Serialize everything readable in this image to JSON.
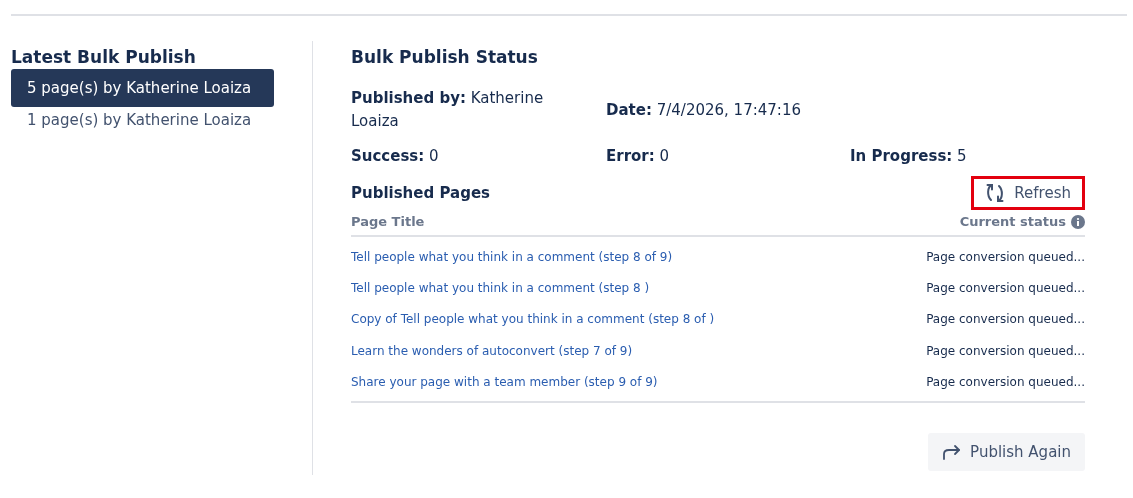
{
  "sidebar": {
    "title": "Latest Bulk Publish",
    "items": [
      {
        "label": "5 page(s) by Katherine Loaiza",
        "selected": true
      },
      {
        "label": "1 page(s) by Katherine Loaiza",
        "selected": false
      }
    ]
  },
  "main": {
    "title": "Bulk Publish Status",
    "field_rows": [
      [
        {
          "label": "Published by:",
          "value": "Katherine Loaiza"
        },
        {
          "label": "Date:",
          "value": "7/4/2026, 17:47:16"
        }
      ],
      [
        {
          "label": "Success:",
          "value": "0"
        },
        {
          "label": "Error:",
          "value": "0"
        },
        {
          "label": "In Progress:",
          "value": "5"
        }
      ]
    ],
    "pages_title": "Published Pages",
    "refresh": {
      "label": "Refresh",
      "highlighted": true
    },
    "table": {
      "columns": [
        "Page Title",
        "Current status"
      ],
      "rows": [
        {
          "title": "Tell people what you think in a comment (step 8 of 9)",
          "status": "Page conversion queued..."
        },
        {
          "title": "Tell people what you think in a comment (step 8 )",
          "status": "Page conversion queued..."
        },
        {
          "title": "Copy of Tell people what you think in a comment (step 8 of )",
          "status": "Page conversion queued..."
        },
        {
          "title": "Learn the wonders of autoconvert (step 7 of 9)",
          "status": "Page conversion queued..."
        },
        {
          "title": "Share your page with a team member (step 9 of 9)",
          "status": "Page conversion queued..."
        }
      ]
    },
    "publish_again": {
      "label": "Publish Again"
    }
  }
}
